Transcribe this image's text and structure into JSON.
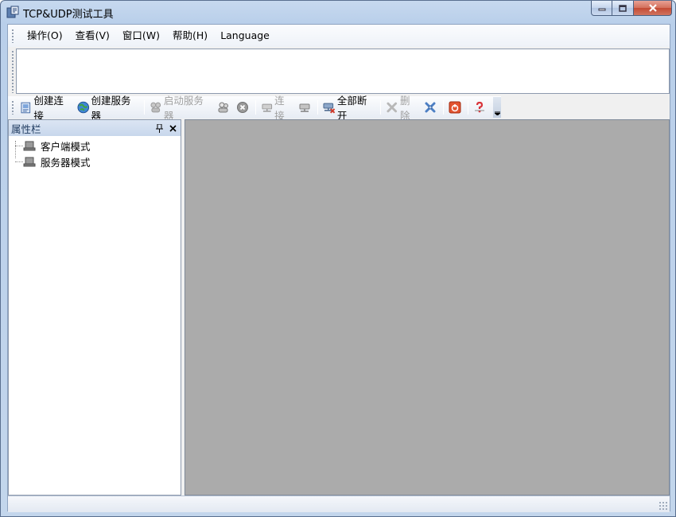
{
  "window": {
    "title": "TCP&UDP测试工具"
  },
  "menu": {
    "items": [
      "操作(O)",
      "查看(V)",
      "窗口(W)",
      "帮助(H)",
      "Language"
    ]
  },
  "toolbar": {
    "create_connection": "创建连接",
    "create_server": "创建服务器",
    "start_server": "启动服务器",
    "connect": "连接",
    "disconnect_all": "全部断开",
    "delete": "删除"
  },
  "property_panel": {
    "title": "属性栏",
    "tree": [
      "客户端模式",
      "服务器模式"
    ]
  },
  "colors": {
    "mdi_background": "#ababab",
    "close_button": "#c44a33"
  }
}
